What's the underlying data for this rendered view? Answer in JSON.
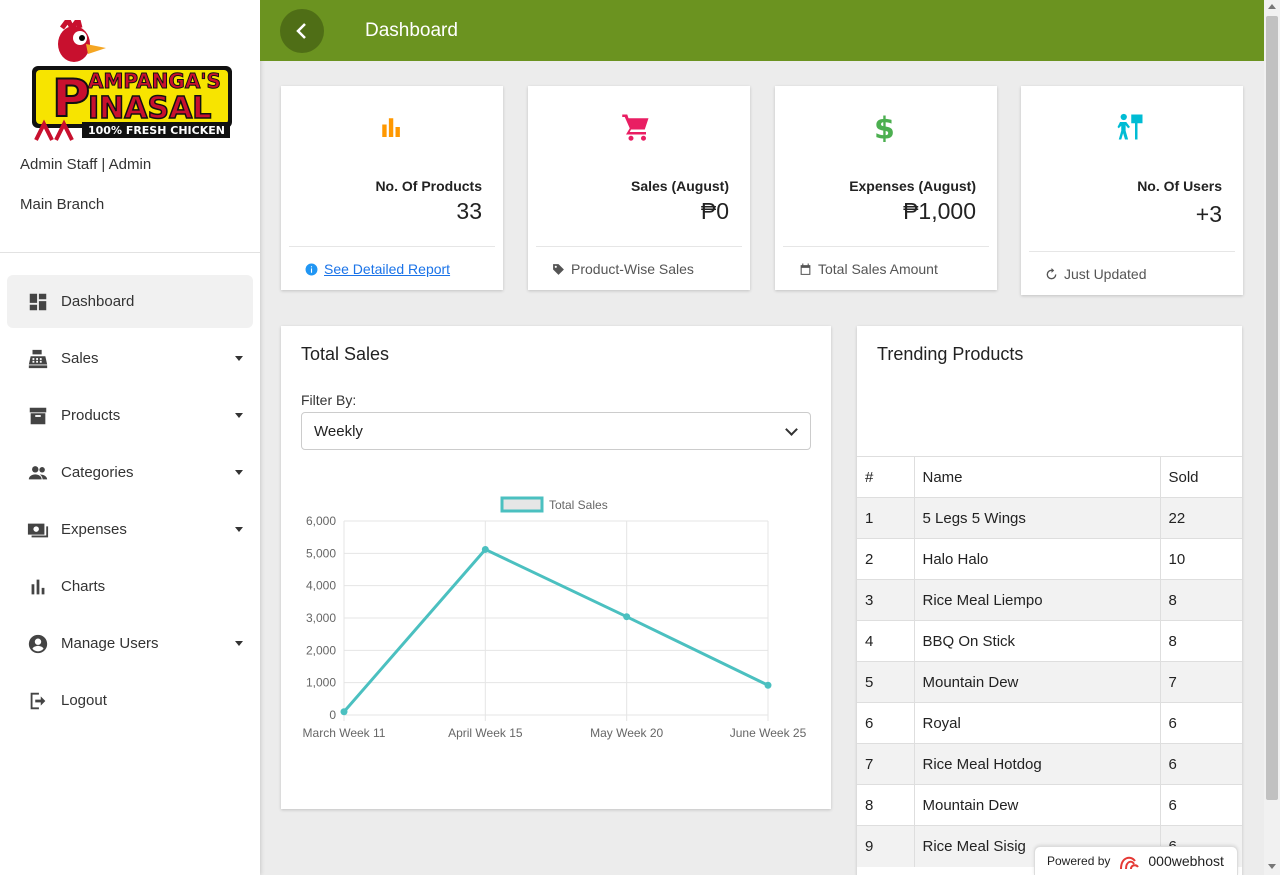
{
  "sidebar": {
    "logo_text": "PAMPANGA'S PINASAL 100% FRESH CHICKEN",
    "user": "Admin Staff | Admin",
    "branch": "Main Branch",
    "items": [
      {
        "label": "Dashboard",
        "icon": "dashboard-icon",
        "active": true,
        "dropdown": false
      },
      {
        "label": "Sales",
        "icon": "cash-register-icon",
        "active": false,
        "dropdown": true
      },
      {
        "label": "Products",
        "icon": "archive-icon",
        "active": false,
        "dropdown": true
      },
      {
        "label": "Categories",
        "icon": "people-icon",
        "active": false,
        "dropdown": true
      },
      {
        "label": "Expenses",
        "icon": "money-icon",
        "active": false,
        "dropdown": true
      },
      {
        "label": "Charts",
        "icon": "bar-chart-icon",
        "active": false,
        "dropdown": false
      },
      {
        "label": "Manage Users",
        "icon": "account-circle-icon",
        "active": false,
        "dropdown": true
      },
      {
        "label": "Logout",
        "icon": "logout-icon",
        "active": false,
        "dropdown": false
      }
    ]
  },
  "header": {
    "title": "Dashboard"
  },
  "stats": [
    {
      "label": "No. Of Products",
      "value": "33",
      "footer": "See Detailed Report",
      "icon": "bar-chart-icon",
      "icon_color": "#ff9800"
    },
    {
      "label": "Sales (August)",
      "value": "₱0",
      "footer": "Product-Wise Sales",
      "icon": "cart-icon",
      "icon_color": "#e91e63"
    },
    {
      "label": "Expenses (August)",
      "value": "₱1,000",
      "footer": "Total Sales Amount",
      "icon": "dollar-icon",
      "icon_color": "#4caf50"
    },
    {
      "label": "No. Of Users",
      "value": "+3",
      "footer": "Just Updated",
      "icon": "user-icon",
      "icon_color": "#00bcd4"
    }
  ],
  "sales_panel": {
    "title": "Total Sales",
    "filter_label": "Filter By:",
    "filter_value": "Weekly"
  },
  "chart_data": {
    "type": "line",
    "x": [
      "March Week 11",
      "April Week 15",
      "May Week 20",
      "June Week 25"
    ],
    "series": [
      {
        "name": "Total Sales",
        "values": [
          100,
          5120,
          3040,
          920
        ],
        "color": "#4bc0c0"
      }
    ],
    "ylim": [
      0,
      6000
    ],
    "yticks": [
      "0",
      "1,000",
      "2,000",
      "3,000",
      "4,000",
      "5,000",
      "6,000"
    ],
    "grid": true,
    "legend": "top"
  },
  "trending": {
    "title": "Trending Products",
    "columns": [
      "#",
      "Name",
      "Sold"
    ],
    "rows": [
      [
        "1",
        "5 Legs 5 Wings",
        "22"
      ],
      [
        "2",
        "Halo Halo",
        "10"
      ],
      [
        "3",
        "Rice Meal Liempo",
        "8"
      ],
      [
        "4",
        "BBQ On Stick",
        "8"
      ],
      [
        "5",
        "Mountain Dew",
        "7"
      ],
      [
        "6",
        "Royal",
        "6"
      ],
      [
        "7",
        "Rice Meal Hotdog",
        "6"
      ],
      [
        "8",
        "Mountain Dew",
        "6"
      ],
      [
        "9",
        "Rice Meal Sisig",
        "6"
      ]
    ]
  },
  "powered": {
    "prefix": "Powered by",
    "brand": "000webhost"
  }
}
